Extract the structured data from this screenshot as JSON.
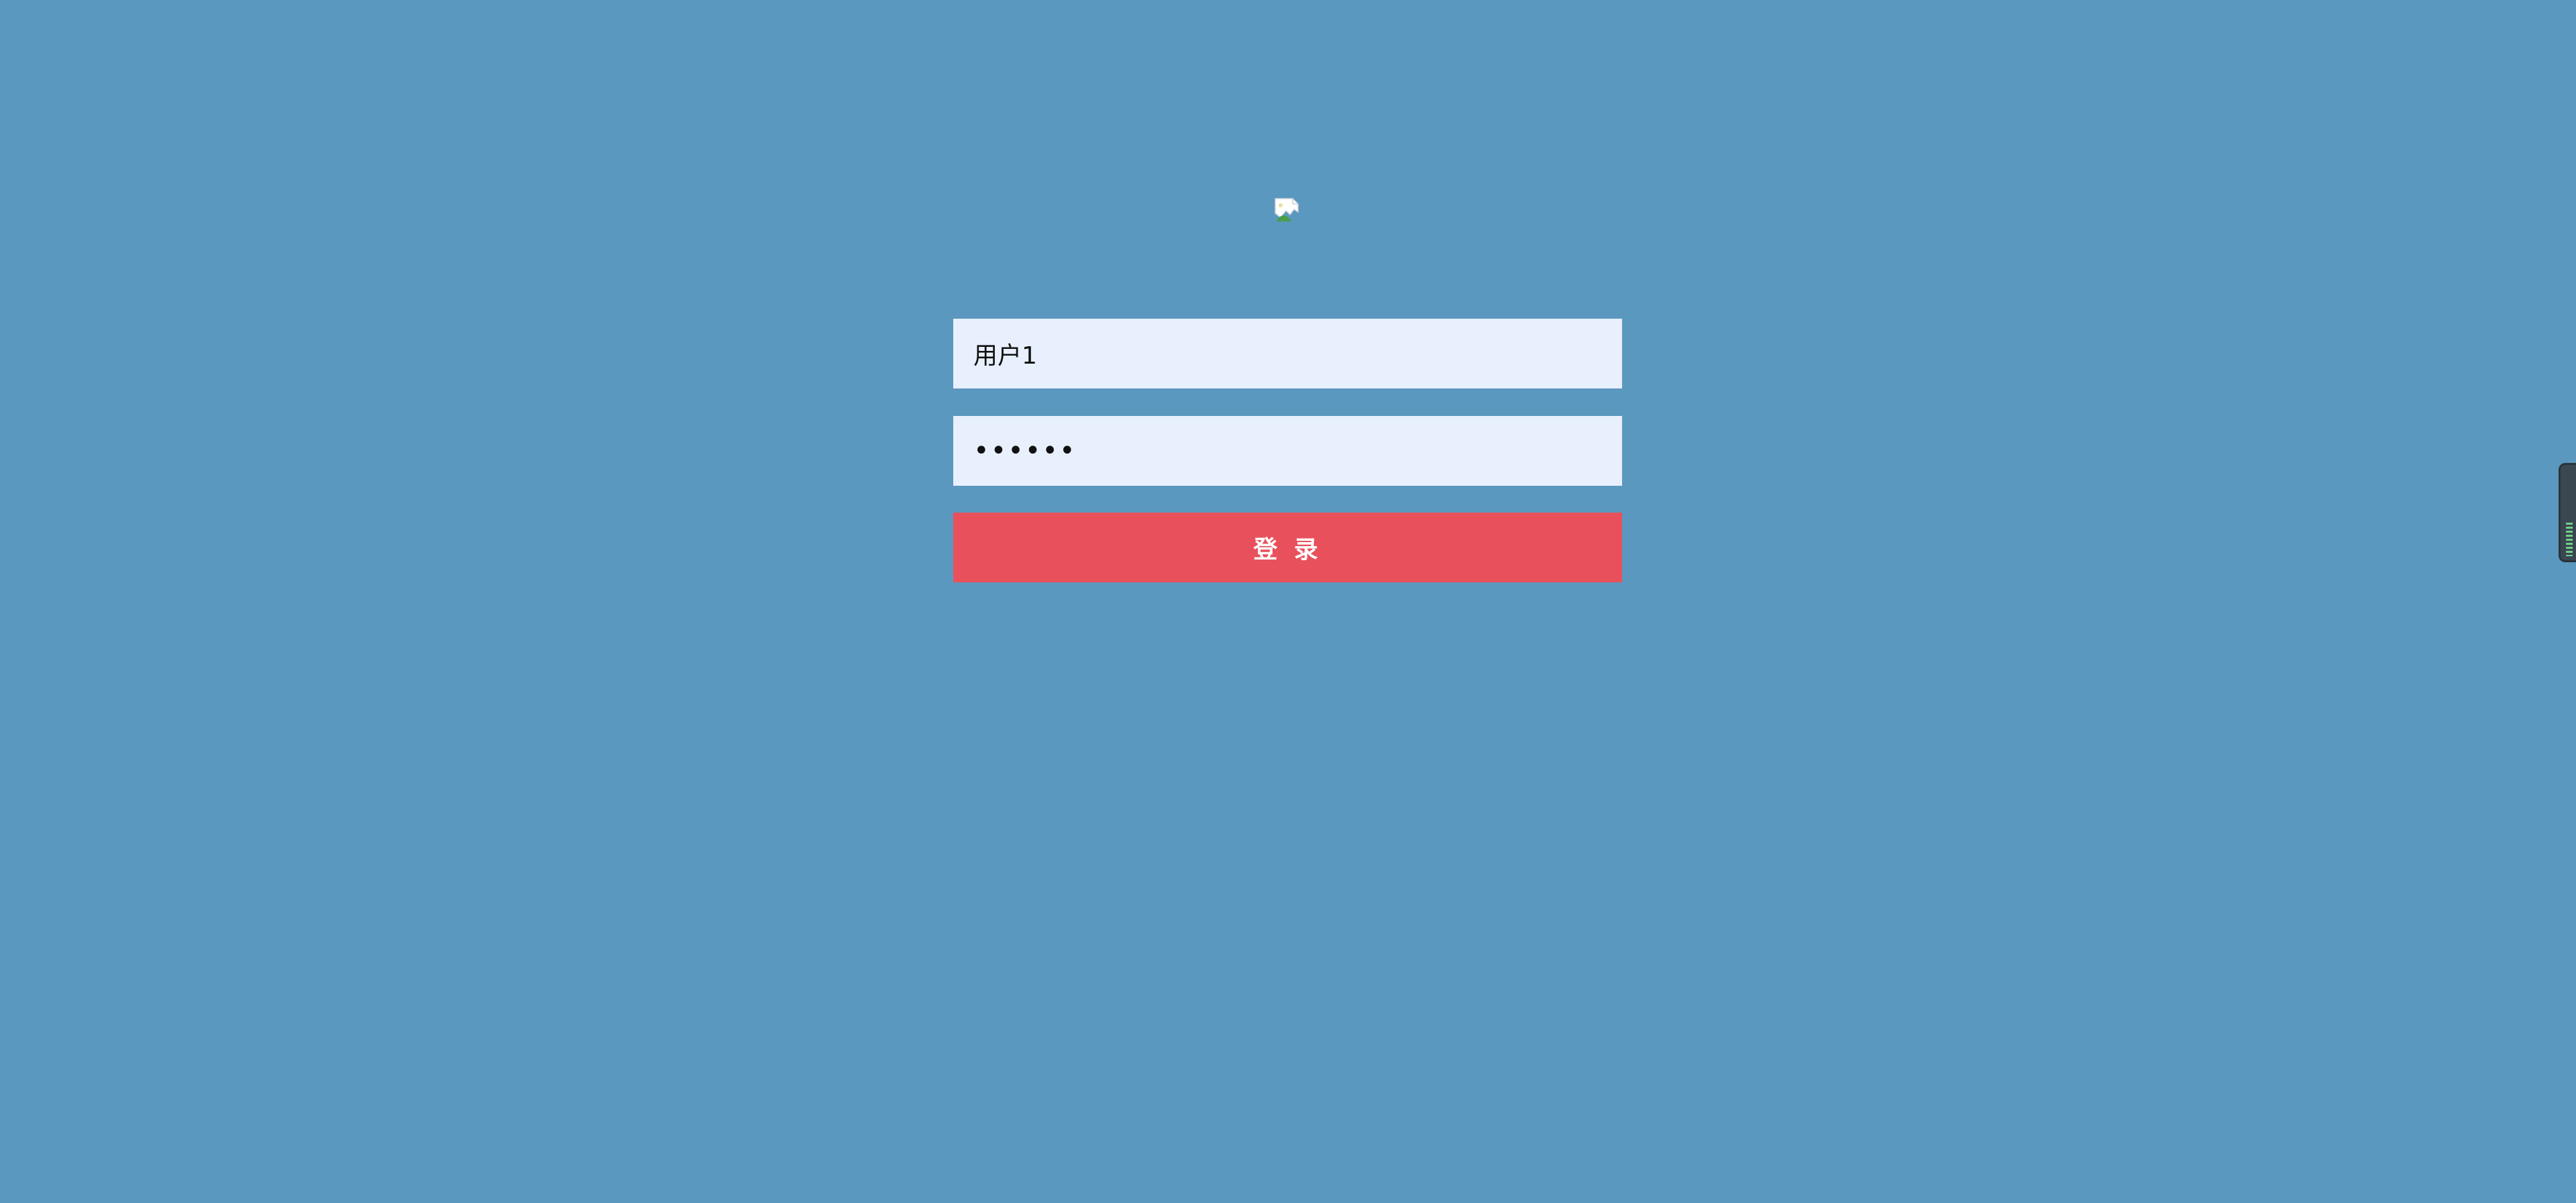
{
  "login": {
    "username_value": "用户1",
    "password_value": "••••••",
    "submit_label": "登 录"
  },
  "icons": {
    "logo": "broken-image-icon",
    "side_widget": "level-meter-icon"
  },
  "colors": {
    "background": "#5b98bf",
    "input_background": "#e8f0fe",
    "button_background": "#e8515c",
    "button_text": "#ffffff"
  }
}
